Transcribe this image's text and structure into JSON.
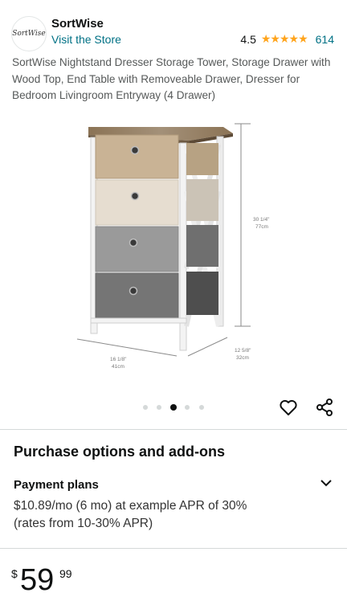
{
  "header": {
    "logo_text": "SortWise",
    "brand_name": "SortWise",
    "store_link": "Visit the Store",
    "rating_value": "4.5",
    "rating_stars": "★★★★★",
    "rating_count": "614"
  },
  "product": {
    "title": "SortWise Nightstand Dresser Storage Tower, Storage Drawer with Wood Top, End Table with Removeable Drawer, Dresser for Bedroom Livingroom Entryway (4 Drawer)",
    "dimensions": {
      "height_in": "30 1/4\"",
      "height_cm": "77cm",
      "width_in": "16 1/8\"",
      "width_cm": "41cm",
      "depth_in": "12 5/8\"",
      "depth_cm": "32cm"
    },
    "image_count": 5,
    "active_image_index": 2
  },
  "icons": {
    "wishlist": "heart-icon",
    "share": "share-icon",
    "expand": "chevron-down-icon"
  },
  "purchase": {
    "section_title": "Purchase options and add-ons",
    "payment_plans_label": "Payment plans",
    "payment_line1": "$10.89/mo (6 mo) at example APR of 30%",
    "payment_line2": "(rates from 10-30% APR)"
  },
  "price": {
    "symbol": "$",
    "whole": "59",
    "fraction": "99"
  },
  "colors": {
    "link": "#007185",
    "star": "#ffa41c",
    "text": "#0f1111"
  }
}
